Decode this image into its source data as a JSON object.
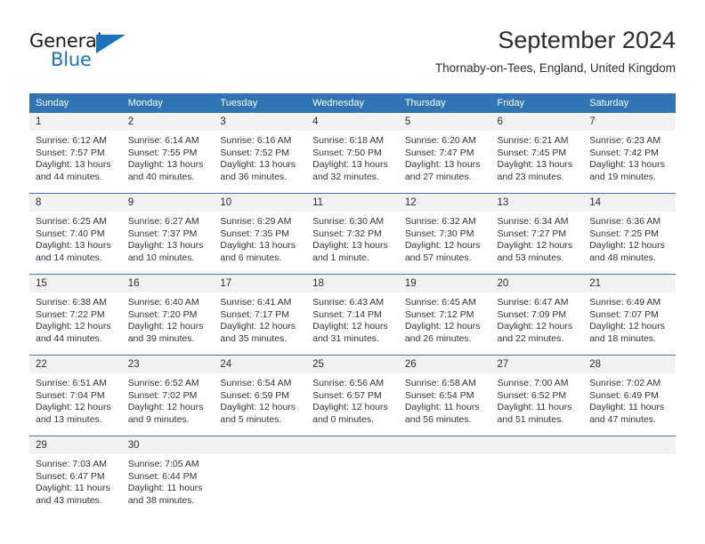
{
  "brand": {
    "name_line1": "General",
    "name_line2": "Blue",
    "primary_color": "#2f75b6",
    "logo_icon": "triangle-icon"
  },
  "header": {
    "title": "September 2024",
    "subtitle": "Thornaby-on-Tees, England, United Kingdom"
  },
  "calendar": {
    "weekday_headers": [
      "Sunday",
      "Monday",
      "Tuesday",
      "Wednesday",
      "Thursday",
      "Friday",
      "Saturday"
    ],
    "header_bg": "#2f75b6",
    "daynum_bg": "#f2f2f2",
    "weeks": [
      [
        {
          "day": "1",
          "sunrise": "Sunrise: 6:12 AM",
          "sunset": "Sunset: 7:57 PM",
          "daylight1": "Daylight: 13 hours",
          "daylight2": "and 44 minutes."
        },
        {
          "day": "2",
          "sunrise": "Sunrise: 6:14 AM",
          "sunset": "Sunset: 7:55 PM",
          "daylight1": "Daylight: 13 hours",
          "daylight2": "and 40 minutes."
        },
        {
          "day": "3",
          "sunrise": "Sunrise: 6:16 AM",
          "sunset": "Sunset: 7:52 PM",
          "daylight1": "Daylight: 13 hours",
          "daylight2": "and 36 minutes."
        },
        {
          "day": "4",
          "sunrise": "Sunrise: 6:18 AM",
          "sunset": "Sunset: 7:50 PM",
          "daylight1": "Daylight: 13 hours",
          "daylight2": "and 32 minutes."
        },
        {
          "day": "5",
          "sunrise": "Sunrise: 6:20 AM",
          "sunset": "Sunset: 7:47 PM",
          "daylight1": "Daylight: 13 hours",
          "daylight2": "and 27 minutes."
        },
        {
          "day": "6",
          "sunrise": "Sunrise: 6:21 AM",
          "sunset": "Sunset: 7:45 PM",
          "daylight1": "Daylight: 13 hours",
          "daylight2": "and 23 minutes."
        },
        {
          "day": "7",
          "sunrise": "Sunrise: 6:23 AM",
          "sunset": "Sunset: 7:42 PM",
          "daylight1": "Daylight: 13 hours",
          "daylight2": "and 19 minutes."
        }
      ],
      [
        {
          "day": "8",
          "sunrise": "Sunrise: 6:25 AM",
          "sunset": "Sunset: 7:40 PM",
          "daylight1": "Daylight: 13 hours",
          "daylight2": "and 14 minutes."
        },
        {
          "day": "9",
          "sunrise": "Sunrise: 6:27 AM",
          "sunset": "Sunset: 7:37 PM",
          "daylight1": "Daylight: 13 hours",
          "daylight2": "and 10 minutes."
        },
        {
          "day": "10",
          "sunrise": "Sunrise: 6:29 AM",
          "sunset": "Sunset: 7:35 PM",
          "daylight1": "Daylight: 13 hours",
          "daylight2": "and 6 minutes."
        },
        {
          "day": "11",
          "sunrise": "Sunrise: 6:30 AM",
          "sunset": "Sunset: 7:32 PM",
          "daylight1": "Daylight: 13 hours",
          "daylight2": "and 1 minute."
        },
        {
          "day": "12",
          "sunrise": "Sunrise: 6:32 AM",
          "sunset": "Sunset: 7:30 PM",
          "daylight1": "Daylight: 12 hours",
          "daylight2": "and 57 minutes."
        },
        {
          "day": "13",
          "sunrise": "Sunrise: 6:34 AM",
          "sunset": "Sunset: 7:27 PM",
          "daylight1": "Daylight: 12 hours",
          "daylight2": "and 53 minutes."
        },
        {
          "day": "14",
          "sunrise": "Sunrise: 6:36 AM",
          "sunset": "Sunset: 7:25 PM",
          "daylight1": "Daylight: 12 hours",
          "daylight2": "and 48 minutes."
        }
      ],
      [
        {
          "day": "15",
          "sunrise": "Sunrise: 6:38 AM",
          "sunset": "Sunset: 7:22 PM",
          "daylight1": "Daylight: 12 hours",
          "daylight2": "and 44 minutes."
        },
        {
          "day": "16",
          "sunrise": "Sunrise: 6:40 AM",
          "sunset": "Sunset: 7:20 PM",
          "daylight1": "Daylight: 12 hours",
          "daylight2": "and 39 minutes."
        },
        {
          "day": "17",
          "sunrise": "Sunrise: 6:41 AM",
          "sunset": "Sunset: 7:17 PM",
          "daylight1": "Daylight: 12 hours",
          "daylight2": "and 35 minutes."
        },
        {
          "day": "18",
          "sunrise": "Sunrise: 6:43 AM",
          "sunset": "Sunset: 7:14 PM",
          "daylight1": "Daylight: 12 hours",
          "daylight2": "and 31 minutes."
        },
        {
          "day": "19",
          "sunrise": "Sunrise: 6:45 AM",
          "sunset": "Sunset: 7:12 PM",
          "daylight1": "Daylight: 12 hours",
          "daylight2": "and 26 minutes."
        },
        {
          "day": "20",
          "sunrise": "Sunrise: 6:47 AM",
          "sunset": "Sunset: 7:09 PM",
          "daylight1": "Daylight: 12 hours",
          "daylight2": "and 22 minutes."
        },
        {
          "day": "21",
          "sunrise": "Sunrise: 6:49 AM",
          "sunset": "Sunset: 7:07 PM",
          "daylight1": "Daylight: 12 hours",
          "daylight2": "and 18 minutes."
        }
      ],
      [
        {
          "day": "22",
          "sunrise": "Sunrise: 6:51 AM",
          "sunset": "Sunset: 7:04 PM",
          "daylight1": "Daylight: 12 hours",
          "daylight2": "and 13 minutes."
        },
        {
          "day": "23",
          "sunrise": "Sunrise: 6:52 AM",
          "sunset": "Sunset: 7:02 PM",
          "daylight1": "Daylight: 12 hours",
          "daylight2": "and 9 minutes."
        },
        {
          "day": "24",
          "sunrise": "Sunrise: 6:54 AM",
          "sunset": "Sunset: 6:59 PM",
          "daylight1": "Daylight: 12 hours",
          "daylight2": "and 5 minutes."
        },
        {
          "day": "25",
          "sunrise": "Sunrise: 6:56 AM",
          "sunset": "Sunset: 6:57 PM",
          "daylight1": "Daylight: 12 hours",
          "daylight2": "and 0 minutes."
        },
        {
          "day": "26",
          "sunrise": "Sunrise: 6:58 AM",
          "sunset": "Sunset: 6:54 PM",
          "daylight1": "Daylight: 11 hours",
          "daylight2": "and 56 minutes."
        },
        {
          "day": "27",
          "sunrise": "Sunrise: 7:00 AM",
          "sunset": "Sunset: 6:52 PM",
          "daylight1": "Daylight: 11 hours",
          "daylight2": "and 51 minutes."
        },
        {
          "day": "28",
          "sunrise": "Sunrise: 7:02 AM",
          "sunset": "Sunset: 6:49 PM",
          "daylight1": "Daylight: 11 hours",
          "daylight2": "and 47 minutes."
        }
      ],
      [
        {
          "day": "29",
          "sunrise": "Sunrise: 7:03 AM",
          "sunset": "Sunset: 6:47 PM",
          "daylight1": "Daylight: 11 hours",
          "daylight2": "and 43 minutes."
        },
        {
          "day": "30",
          "sunrise": "Sunrise: 7:05 AM",
          "sunset": "Sunset: 6:44 PM",
          "daylight1": "Daylight: 11 hours",
          "daylight2": "and 38 minutes."
        },
        {
          "day": "",
          "sunrise": "",
          "sunset": "",
          "daylight1": "",
          "daylight2": ""
        },
        {
          "day": "",
          "sunrise": "",
          "sunset": "",
          "daylight1": "",
          "daylight2": ""
        },
        {
          "day": "",
          "sunrise": "",
          "sunset": "",
          "daylight1": "",
          "daylight2": ""
        },
        {
          "day": "",
          "sunrise": "",
          "sunset": "",
          "daylight1": "",
          "daylight2": ""
        },
        {
          "day": "",
          "sunrise": "",
          "sunset": "",
          "daylight1": "",
          "daylight2": ""
        }
      ]
    ]
  }
}
